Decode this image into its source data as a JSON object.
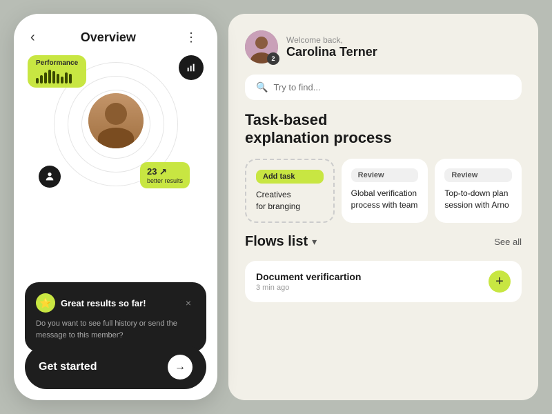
{
  "phone": {
    "header": {
      "back_label": "‹",
      "title": "Overview",
      "menu_icon": "⋮"
    },
    "performance": {
      "label": "Performance",
      "bars": [
        8,
        12,
        16,
        20,
        18,
        14,
        10,
        16,
        14
      ]
    },
    "results_badge": {
      "number": "23 ↗",
      "text": "better results"
    },
    "notification": {
      "title": "Great results so far!",
      "body": "Do you want to see full history\nor send the message to this member?",
      "close": "×"
    },
    "cta": {
      "label": "Get started",
      "arrow": "→"
    }
  },
  "right": {
    "welcome": {
      "sub": "Welcome back,",
      "name": "Carolina Terner",
      "avatar_badge": "2"
    },
    "search": {
      "placeholder": "Try to find..."
    },
    "tasks_section_title": "Task-based\nexplanation process",
    "task_cards": [
      {
        "badge": "Add task",
        "badge_style": "green",
        "text": "Creatives\nfor branging"
      },
      {
        "badge": "Review",
        "badge_style": "gray",
        "text": "Global verification\nprocess with team"
      },
      {
        "badge": "Review",
        "badge_style": "gray",
        "text": "Top-to-down plan\nsession with Arno"
      }
    ],
    "flows": {
      "title": "Flows list",
      "dropdown_icon": "▾",
      "see_all": "See all",
      "items": [
        {
          "title": "Document verificartion",
          "time": "3 min ago"
        }
      ]
    }
  }
}
